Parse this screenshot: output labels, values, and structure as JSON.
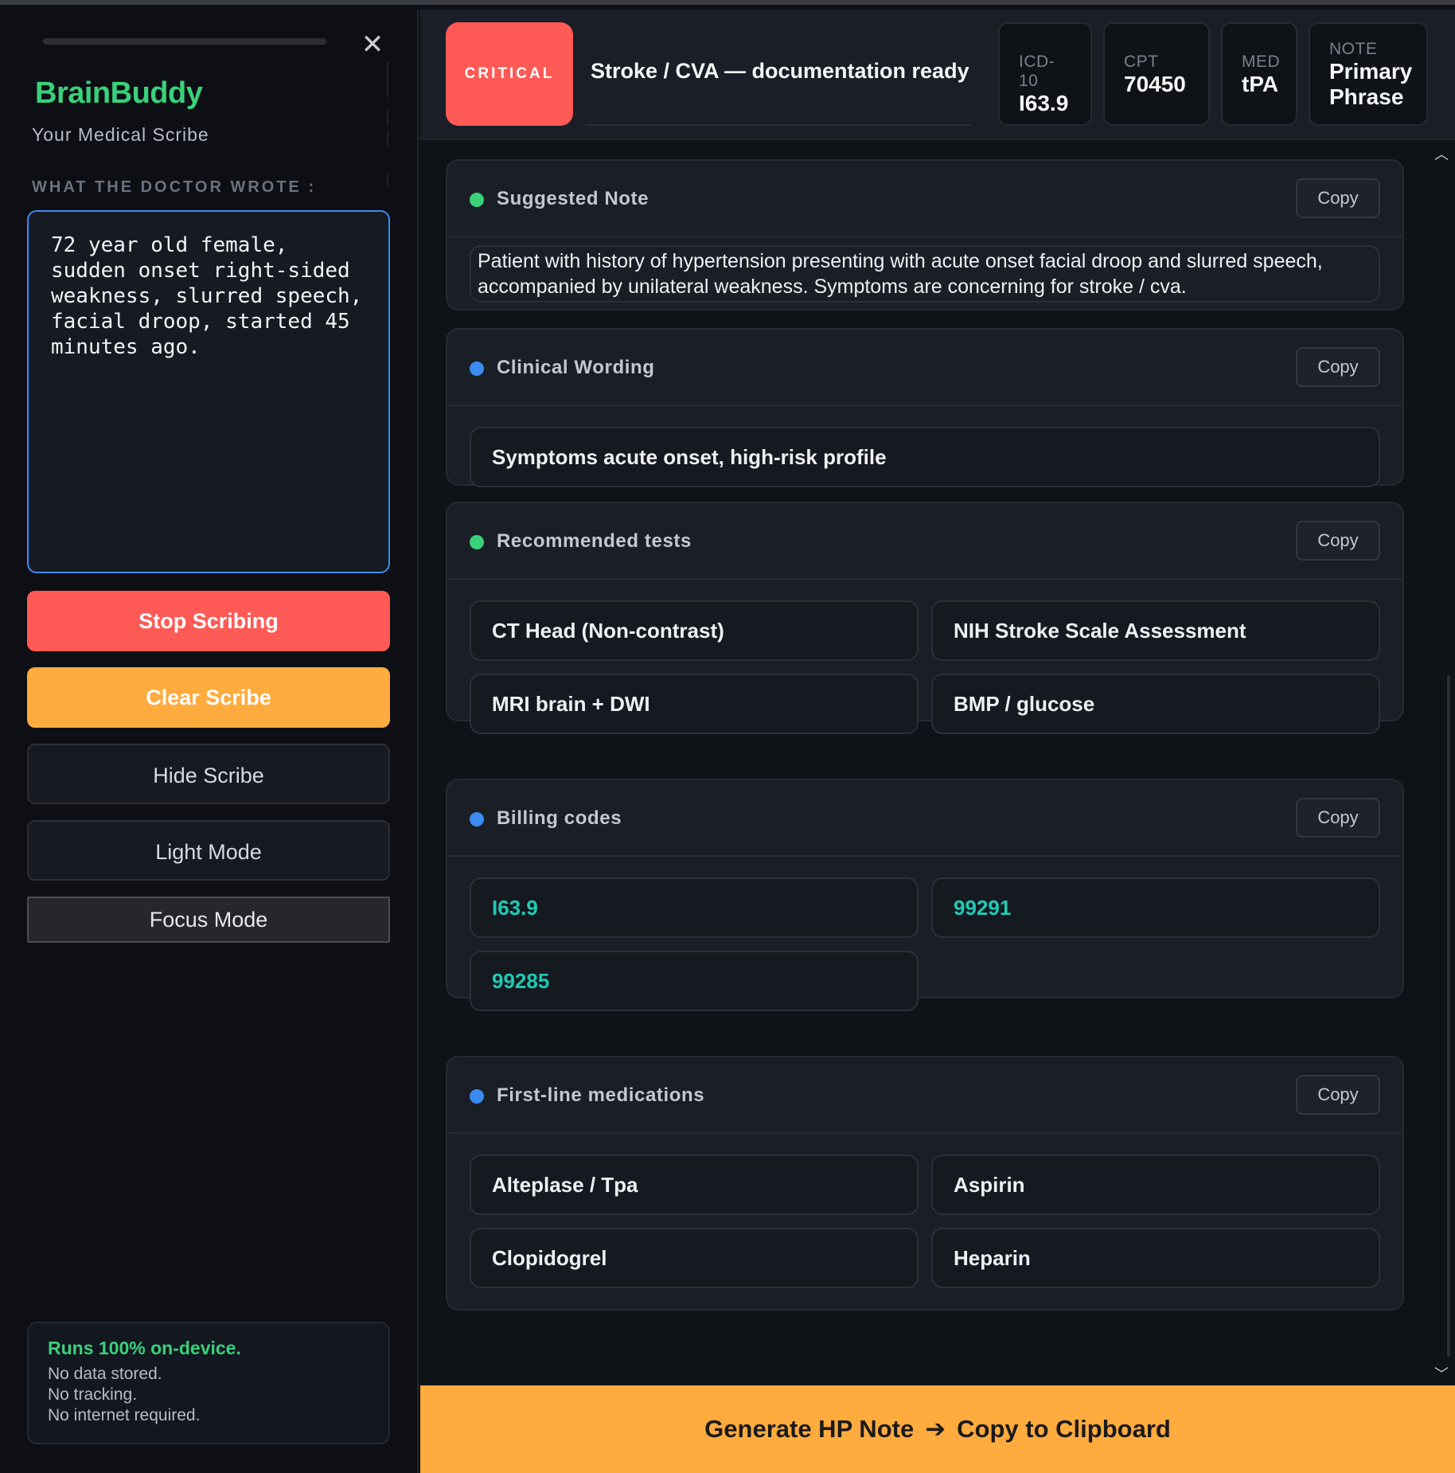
{
  "sidebar": {
    "brand": "BrainBuddy",
    "subtitle": "Your Medical Scribe",
    "input_label": "WHAT THE DOCTOR WROTE :",
    "doctor_note": "72 year old female,\nsudden onset right-sided\nweakness, slurred speech,\nfacial droop, started 45\nminutes ago.",
    "buttons": {
      "stop": "Stop Scribing",
      "clear": "Clear Scribe",
      "hide": "Hide Scribe",
      "light": "Light Mode",
      "focus": "Focus Mode"
    },
    "privacy": {
      "headline": "Runs 100% on-device.",
      "lines": [
        "No data stored.",
        "No tracking.",
        "No internet required."
      ]
    },
    "close_icon": "close-icon"
  },
  "header": {
    "severity": "CRITICAL",
    "title": "Stroke / CVA — documentation ready",
    "chips": {
      "icd": {
        "key": "ICD-10",
        "value": "I63.9"
      },
      "cpt": {
        "key": "CPT",
        "value": "70450"
      },
      "med": {
        "key": "MED",
        "value": "tPA"
      },
      "note": {
        "key": "NOTE",
        "value_line1": "Primary",
        "value_line2": "Phrase"
      }
    }
  },
  "cards": {
    "suggested_note": {
      "title": "Suggested Note",
      "copy": "Copy",
      "text": "Patient with history of hypertension presenting with acute onset facial droop and slurred speech, accompanied by unilateral weakness. Symptoms are concerning for stroke / cva."
    },
    "clinical_wording": {
      "title": "Clinical Wording",
      "copy": "Copy",
      "items": [
        "Symptoms acute onset, high-risk profile"
      ]
    },
    "tests": {
      "title": "Recommended tests",
      "copy": "Copy",
      "items": [
        "CT Head (Non-contrast)",
        "NIH Stroke Scale Assessment",
        "MRI brain + DWI",
        "BMP / glucose"
      ]
    },
    "billing": {
      "title": "Billing codes",
      "copy": "Copy",
      "items": [
        "I63.9",
        "99291",
        "99285"
      ]
    },
    "medications": {
      "title": "First-line medications",
      "copy": "Copy",
      "items": [
        "Alteplase / Tpa",
        "Aspirin",
        "Clopidogrel",
        "Heparin"
      ]
    }
  },
  "footer": {
    "left": "Generate HP Note",
    "arrow": "➔",
    "right": "Copy to Clipboard"
  },
  "colors": {
    "critical": "#ff5a55",
    "accent_orange": "#ffab3e",
    "brand_green": "#39d17a",
    "info_blue": "#3b8bf0",
    "code_teal": "#1ecbb4"
  }
}
